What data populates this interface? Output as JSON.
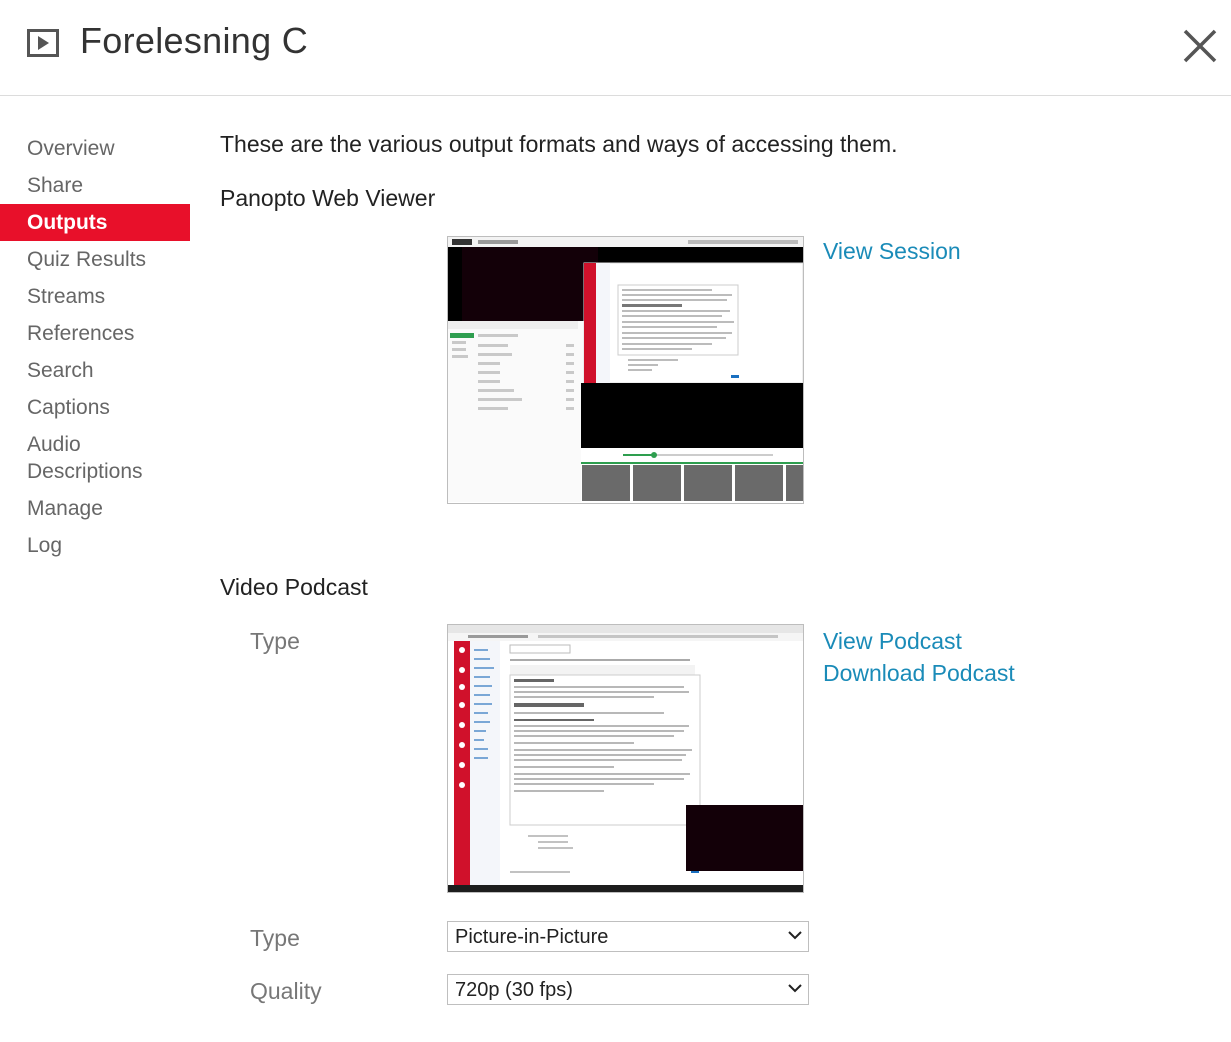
{
  "header": {
    "title": "Forelesning C",
    "icon": "play-icon",
    "close_icon": "close-icon"
  },
  "sidebar": {
    "items": [
      {
        "label": "Overview"
      },
      {
        "label": "Share"
      },
      {
        "label": "Outputs",
        "active": true
      },
      {
        "label": "Quiz Results"
      },
      {
        "label": "Streams"
      },
      {
        "label": "References"
      },
      {
        "label": "Search"
      },
      {
        "label": "Captions"
      },
      {
        "label": "Audio Descriptions"
      },
      {
        "label": "Manage"
      },
      {
        "label": "Log"
      }
    ]
  },
  "main": {
    "intro": "These are the various output formats and ways of accessing them.",
    "web_viewer": {
      "title": "Panopto Web Viewer",
      "view_session": "View Session"
    },
    "podcast": {
      "title": "Video Podcast",
      "type_label": "Type",
      "view_podcast": "View Podcast",
      "download_podcast": "Download Podcast",
      "type_select_label": "Type",
      "type_value": "Picture-in-Picture",
      "quality_label": "Quality",
      "quality_value": "720p (30 fps)"
    }
  },
  "colors": {
    "accent": "#e8102a",
    "link": "#1a8bb8"
  }
}
